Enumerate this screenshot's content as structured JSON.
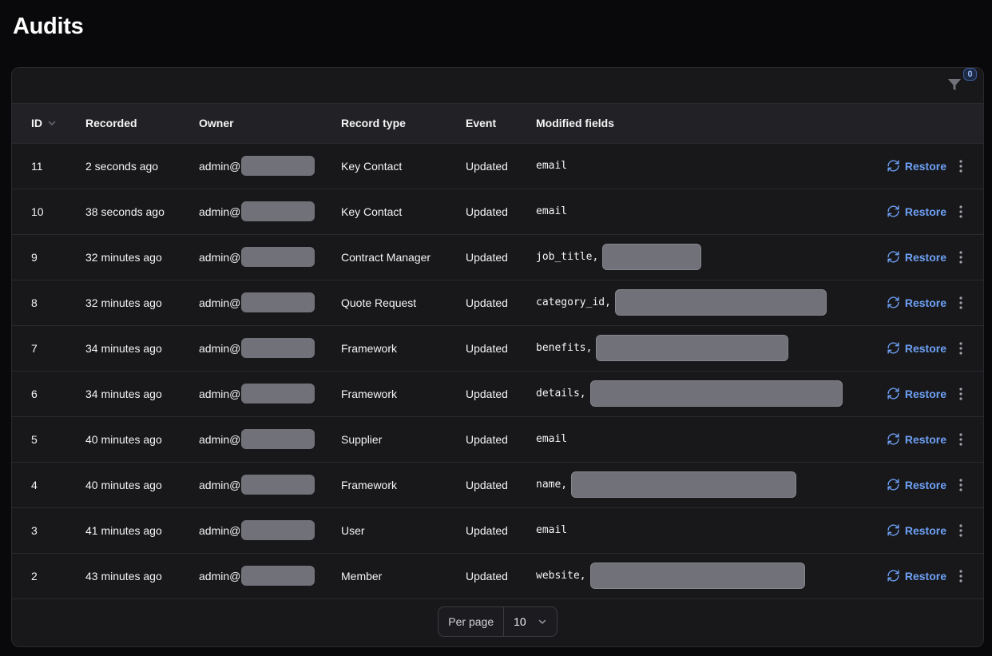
{
  "page": {
    "title": "Audits"
  },
  "filters": {
    "badge_count": "0",
    "icon": "filter-icon"
  },
  "table": {
    "columns": {
      "id": "ID",
      "recorded": "Recorded",
      "owner": "Owner",
      "record_type": "Record type",
      "event": "Event",
      "modified_fields": "Modified fields"
    },
    "rows": [
      {
        "id": "11",
        "recorded": "2 seconds ago",
        "owner": "admin@",
        "record_type": "Key Contact",
        "event": "Updated",
        "fields": "email",
        "fields_redacted": false
      },
      {
        "id": "10",
        "recorded": "38 seconds ago",
        "owner": "admin@",
        "record_type": "Key Contact",
        "event": "Updated",
        "fields": "email",
        "fields_redacted": false
      },
      {
        "id": "9",
        "recorded": "32 minutes ago",
        "owner": "admin@",
        "record_type": "Contract Manager",
        "event": "Updated",
        "fields": "job_title,",
        "fields_redacted": true
      },
      {
        "id": "8",
        "recorded": "32 minutes ago",
        "owner": "admin@",
        "record_type": "Quote Request",
        "event": "Updated",
        "fields": "category_id,",
        "fields_redacted": true
      },
      {
        "id": "7",
        "recorded": "34 minutes ago",
        "owner": "admin@",
        "record_type": "Framework",
        "event": "Updated",
        "fields": "benefits,",
        "fields_redacted": true
      },
      {
        "id": "6",
        "recorded": "34 minutes ago",
        "owner": "admin@",
        "record_type": "Framework",
        "event": "Updated",
        "fields": "details,",
        "fields_redacted": true
      },
      {
        "id": "5",
        "recorded": "40 minutes ago",
        "owner": "admin@",
        "record_type": "Supplier",
        "event": "Updated",
        "fields": "email",
        "fields_redacted": false
      },
      {
        "id": "4",
        "recorded": "40 minutes ago",
        "owner": "admin@",
        "record_type": "Framework",
        "event": "Updated",
        "fields": "name,",
        "fields_redacted": true
      },
      {
        "id": "3",
        "recorded": "41 minutes ago",
        "owner": "admin@",
        "record_type": "User",
        "event": "Updated",
        "fields": "email",
        "fields_redacted": false
      },
      {
        "id": "2",
        "recorded": "43 minutes ago",
        "owner": "admin@",
        "record_type": "Member",
        "event": "Updated",
        "fields": "website,",
        "fields_redacted": true
      }
    ],
    "row_action_label": "Restore"
  },
  "pagination": {
    "per_page_label": "Per page",
    "per_page_value": "10"
  },
  "colors": {
    "accent": "#6ea1f5",
    "background": "#09090b",
    "card": "#18181b",
    "redaction": "#71717a"
  }
}
